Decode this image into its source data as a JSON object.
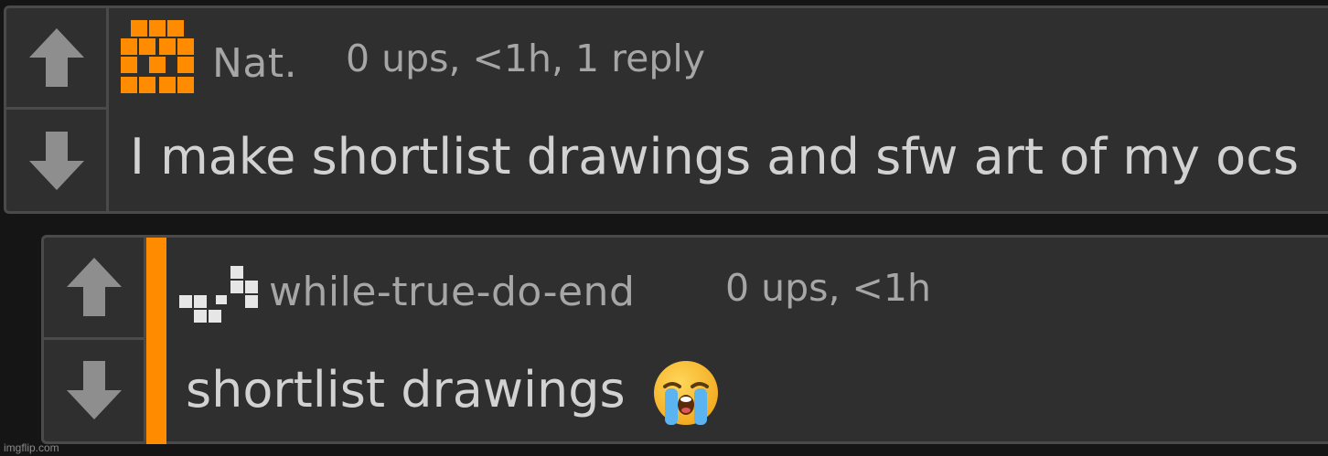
{
  "comments": [
    {
      "username": "Nat.",
      "meta": "0 ups, <1h, 1 reply",
      "text": "I make shortlist drawings and sfw art of my ocs",
      "upvote_icon": "arrow-up-icon",
      "downvote_icon": "arrow-down-icon",
      "avatar_color": "#ff8c00"
    },
    {
      "username": "while-true-do-end",
      "meta": "0 ups, <1h",
      "text": "shortlist drawings",
      "emoji": "loudly-crying-face",
      "upvote_icon": "arrow-up-icon",
      "downvote_icon": "arrow-down-icon",
      "avatar_color": "#e6e6e6",
      "reply_bar_color": "#ff8c00"
    }
  ],
  "watermark": "imgflip.com"
}
